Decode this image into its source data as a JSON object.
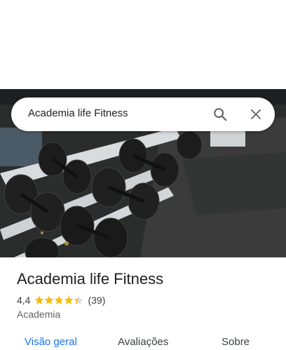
{
  "search": {
    "query": "Academia life Fitness"
  },
  "icons": {
    "search": "search-icon",
    "close": "close-icon",
    "photo": "gym-dumbbells-photo"
  },
  "place": {
    "name": "Academia life Fitness",
    "rating": "4,4",
    "rating_value": 4.4,
    "reviews": "(39)",
    "category": "Academia"
  },
  "tabs": [
    {
      "label": "Visão geral"
    },
    {
      "label": "Avaliações"
    },
    {
      "label": "Sobre"
    }
  ],
  "colors": {
    "accent": "#1a73e8",
    "star": "#fbbc04",
    "text": "#202124",
    "muted": "#5f6368"
  }
}
